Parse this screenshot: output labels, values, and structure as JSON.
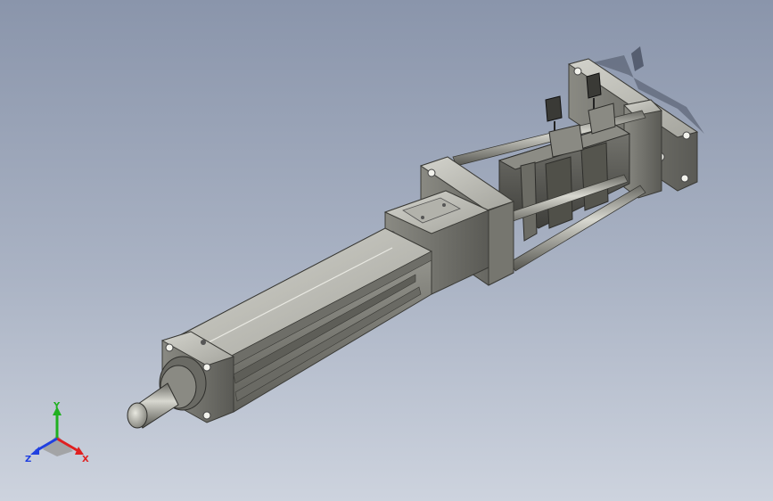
{
  "view": {
    "background_top": "#8a95ab",
    "background_bottom": "#cdd3de",
    "model_color": "#8f8f88",
    "shadow_color": "#4a5263"
  },
  "triad": {
    "x_label": "X",
    "y_label": "Y",
    "z_label": "Z",
    "x_color": "#e02020",
    "y_color": "#20b020",
    "z_color": "#2040e0"
  }
}
